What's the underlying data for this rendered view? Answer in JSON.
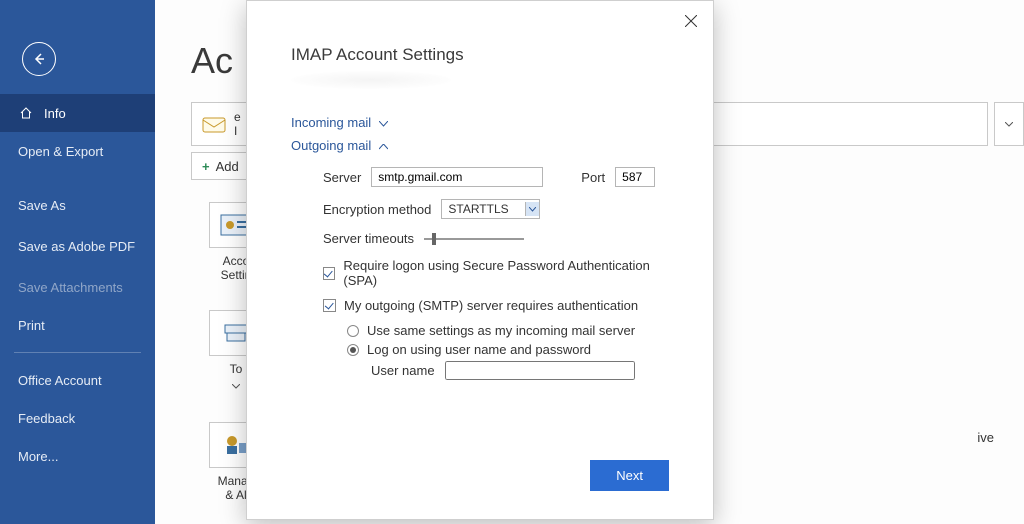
{
  "titlebar": {
    "smile_icon": "smile",
    "frown_icon": "frown",
    "help": "?",
    "minimize": "–",
    "maximize": "□",
    "close": "×"
  },
  "sidebar": {
    "items": [
      {
        "label": "Info",
        "icon": "home"
      },
      {
        "label": "Open & Export",
        "icon": ""
      },
      {
        "label": "Save As",
        "icon": ""
      },
      {
        "label": "Save as Adobe PDF",
        "icon": ""
      },
      {
        "label": "Save Attachments",
        "icon": ""
      },
      {
        "label": "Print",
        "icon": ""
      },
      {
        "label": "Office Account",
        "icon": ""
      },
      {
        "label": "Feedback",
        "icon": ""
      },
      {
        "label": "More...",
        "icon": ""
      }
    ]
  },
  "main": {
    "heading": "Ac",
    "combo_line1": "e",
    "combo_line2": "I",
    "add_account": "Add",
    "tiles": [
      {
        "cap1": "Acco",
        "cap2": "Settin"
      },
      {
        "cap1": "To",
        "cap2": ""
      },
      {
        "cap1": "Manag",
        "cap2": "& Al"
      }
    ],
    "right_text": "ive"
  },
  "dialog": {
    "title": "IMAP Account Settings",
    "incoming": "Incoming mail",
    "outgoing": "Outgoing mail",
    "server_label": "Server",
    "server_value": "smtp.gmail.com",
    "port_label": "Port",
    "port_value": "587",
    "encryption_label": "Encryption method",
    "encryption_value": "STARTTLS",
    "timeouts_label": "Server timeouts",
    "spa_label": "Require logon using Secure Password Authentication (SPA)",
    "smtp_auth_label": "My outgoing (SMTP) server requires authentication",
    "radio_same": "Use same settings as my incoming mail server",
    "radio_logon": "Log on using user name and password",
    "username_label": "User name",
    "username_value": "",
    "next": "Next"
  }
}
